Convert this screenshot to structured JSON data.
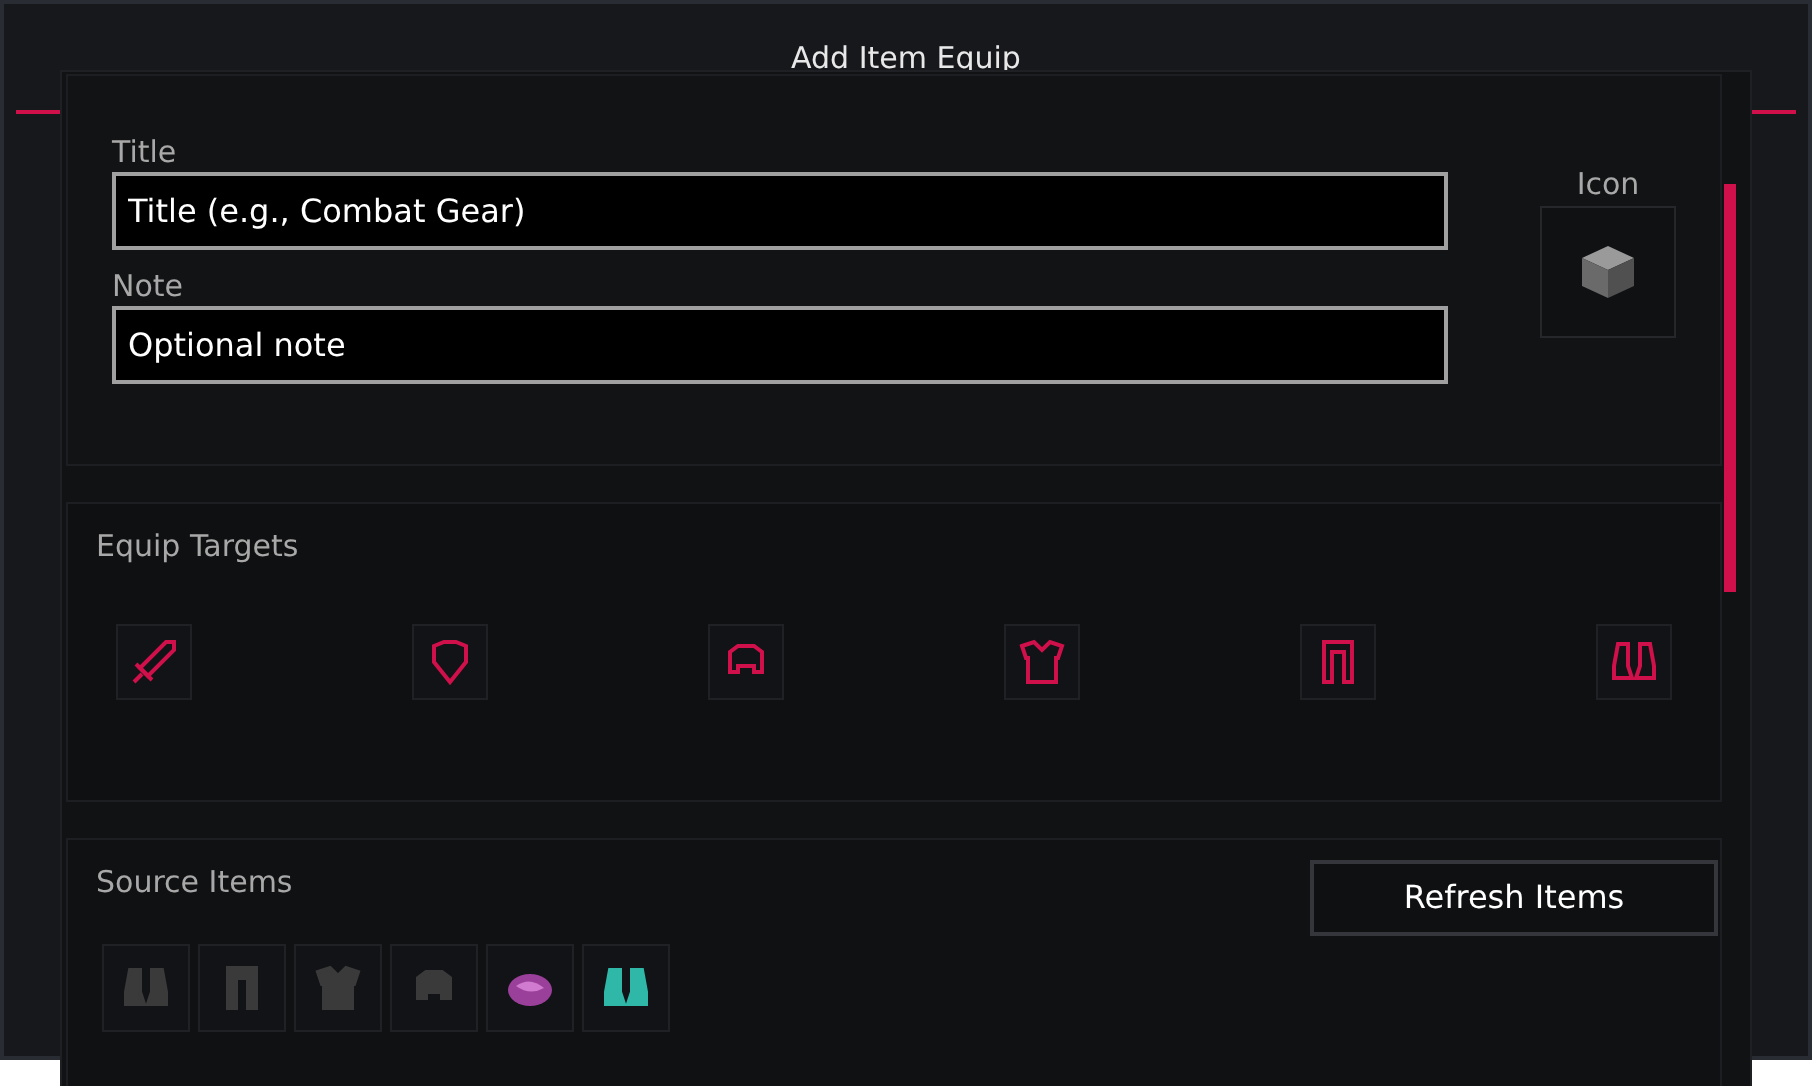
{
  "window": {
    "title": "Add Item Equip"
  },
  "details": {
    "title_label": "Title",
    "title_field": {
      "placeholder": "Title (e.g., Combat Gear)"
    },
    "note_label": "Note",
    "note_field": {
      "placeholder": "Optional note"
    },
    "icon_label": "Icon"
  },
  "equip_targets": {
    "heading": "Equip Targets",
    "slots": [
      {
        "kind": "sword"
      },
      {
        "kind": "shield"
      },
      {
        "kind": "helmet"
      },
      {
        "kind": "chestplate"
      },
      {
        "kind": "leggings"
      },
      {
        "kind": "boots"
      }
    ]
  },
  "source_items": {
    "heading": "Source Items",
    "refresh_button": "Refresh Items",
    "items": [
      {
        "kind": "boots",
        "color": "#3a3a3a"
      },
      {
        "kind": "leggings",
        "color": "#3a3a3a"
      },
      {
        "kind": "chestplate",
        "color": "#3a3a3a"
      },
      {
        "kind": "helmet",
        "color": "#3a3a3a"
      },
      {
        "kind": "elytra",
        "color": "#9a3f9a"
      },
      {
        "kind": "boots",
        "color": "#2fb8a8"
      }
    ]
  }
}
